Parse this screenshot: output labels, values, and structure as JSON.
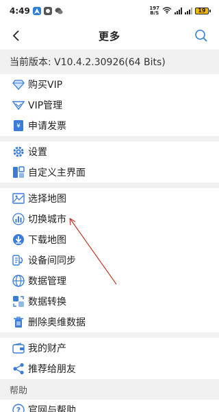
{
  "status_bar": {
    "time": "4:49",
    "net_speed_value": "197",
    "net_speed_unit": "B/S",
    "battery": "19"
  },
  "header": {
    "title": "更多"
  },
  "version": "当前版本: V10.4.2.30926(64 Bits)",
  "groups": [
    [
      {
        "label": "购买VIP",
        "icon": "diamond-icon"
      },
      {
        "label": "VIP管理",
        "icon": "vip-crown-icon"
      },
      {
        "label": "申请发票",
        "icon": "invoice-icon"
      }
    ],
    [
      {
        "label": "设置",
        "icon": "gear-icon"
      },
      {
        "label": "自定义主界面",
        "icon": "grid-layout-icon"
      }
    ],
    [
      {
        "label": "选择地图",
        "icon": "map-icon"
      },
      {
        "label": "切换城市",
        "icon": "city-icon"
      },
      {
        "label": "下载地图",
        "icon": "download-icon"
      },
      {
        "label": "设备间同步",
        "icon": "sync-icon"
      },
      {
        "label": "数据管理",
        "icon": "globe-icon"
      },
      {
        "label": "数据转换",
        "icon": "convert-icon"
      },
      {
        "label": "删除奥维数据",
        "icon": "trash-icon"
      }
    ],
    [
      {
        "label": "我的财产",
        "icon": "wallet-icon"
      },
      {
        "label": "推荐给朋友",
        "icon": "share-icon"
      }
    ]
  ],
  "help_section": {
    "title": "帮助",
    "items": [
      {
        "label": "官网与帮助",
        "icon": "help-icon"
      }
    ]
  },
  "colors": {
    "accent": "#2f7fd6",
    "annotation_arrow": "#c0392b"
  }
}
